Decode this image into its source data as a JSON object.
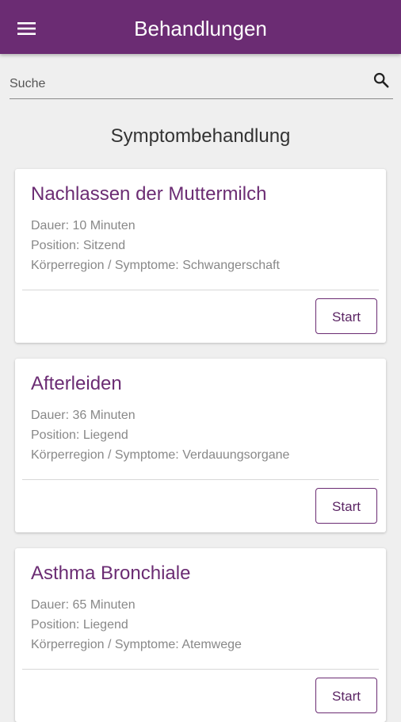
{
  "appbar": {
    "title": "Behandlungen",
    "menu_icon": "hamburger-menu-icon"
  },
  "search": {
    "placeholder": "Suche",
    "value": "",
    "icon": "search-icon"
  },
  "section": {
    "title": "Symptombehandlung"
  },
  "cards": [
    {
      "title": "Nachlassen der Muttermilch",
      "duration": "Dauer: 10 Minuten",
      "position": "Position: Sitzend",
      "region": "Körperregion / Symptome: Schwangerschaft",
      "button": "Start"
    },
    {
      "title": "Afterleiden",
      "duration": "Dauer: 36 Minuten",
      "position": "Position: Liegend",
      "region": "Körperregion / Symptome: Verdauungsorgane",
      "button": "Start"
    },
    {
      "title": "Asthma Bronchiale",
      "duration": "Dauer: 65 Minuten",
      "position": "Position: Liegend",
      "region": "Körperregion / Symptome: Atemwege",
      "button": "Start"
    }
  ],
  "colors": {
    "primary": "#6b2c73",
    "background": "#efefef",
    "card": "#ffffff",
    "meta_text": "#888888"
  }
}
